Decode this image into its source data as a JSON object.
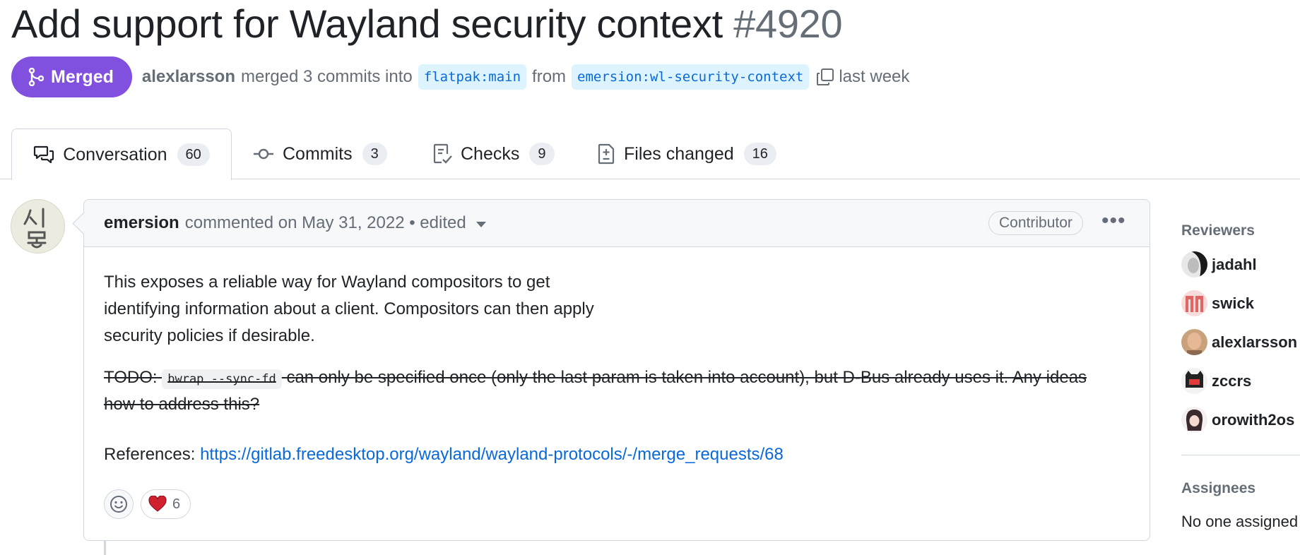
{
  "pr": {
    "title": "Add support for Wayland security context",
    "number": "#4920",
    "status": "Merged",
    "author": "alexlarsson",
    "merge_text": "merged 3 commits into",
    "base_branch": "flatpak:main",
    "from_text": "from",
    "head_branch": "emersion:wl-security-context",
    "time": "last week"
  },
  "tabs": [
    {
      "label": "Conversation",
      "count": "60",
      "icon": "comment-discussion-icon"
    },
    {
      "label": "Commits",
      "count": "3",
      "icon": "git-commit-icon"
    },
    {
      "label": "Checks",
      "count": "9",
      "icon": "checklist-icon"
    },
    {
      "label": "Files changed",
      "count": "16",
      "icon": "file-diff-icon"
    }
  ],
  "comment": {
    "author": "emersion",
    "meta": "commented on May 31, 2022 • edited",
    "role": "Contributor",
    "body1": "This exposes a reliable way for Wayland compositors to get identifying information about a client. Compositors can then apply security policies if desirable.",
    "todo_prefix": "TODO:",
    "todo_code": "bwrap --sync-fd",
    "todo_rest": "can only be specified once (only the last param is taken into account), but D-Bus already uses it. Any ideas how to address this?",
    "references_label": "References:",
    "references_link": "https://gitlab.freedesktop.org/wayland/wayland-protocols/-/merge_requests/68",
    "heart_count": "6"
  },
  "sidebar": {
    "reviewers_heading": "Reviewers",
    "reviewers": [
      "jadahl",
      "swick",
      "alexlarsson",
      "zccrs",
      "orowith2os"
    ],
    "assignees_heading": "Assignees",
    "assignees_value": "No one assigned"
  },
  "colors": {
    "merged": "#8250df",
    "link": "#0969da",
    "branch_bg": "#ddf4ff",
    "heart": "#cf222e"
  }
}
